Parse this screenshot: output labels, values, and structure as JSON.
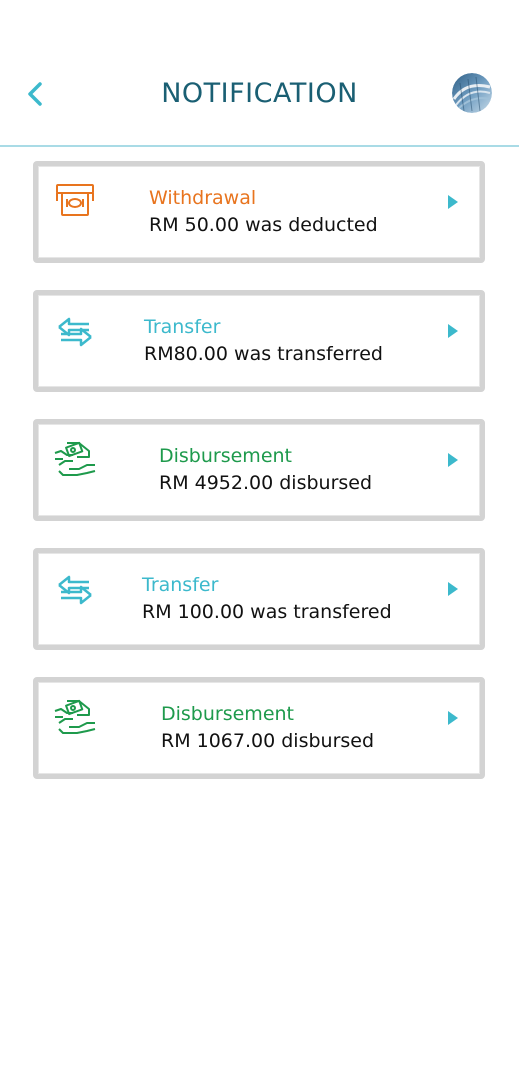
{
  "header": {
    "title": "NOTIFICATION"
  },
  "colors": {
    "accent": "#3cb9cc",
    "withdrawal": "#e8741e",
    "transfer": "#3cb9cc",
    "disbursement": "#1e9a4c",
    "title": "#1a5f73"
  },
  "notifications": [
    {
      "type": "withdrawal",
      "icon": "atm-cash-icon",
      "title": "Withdrawal",
      "message": "RM 50.00 was deducted"
    },
    {
      "type": "transfer",
      "icon": "transfer-arrows-icon",
      "title": "Transfer",
      "message": "RM80.00 was transferred"
    },
    {
      "type": "disbursement",
      "icon": "hand-money-icon",
      "title": "Disbursement",
      "message": "RM 4952.00 disbursed"
    },
    {
      "type": "transfer",
      "icon": "transfer-arrows-icon",
      "title": "Transfer",
      "message": "RM 100.00 was transfered"
    },
    {
      "type": "disbursement",
      "icon": "hand-money-icon",
      "title": "Disbursement",
      "message": "RM 1067.00 disbursed"
    }
  ]
}
